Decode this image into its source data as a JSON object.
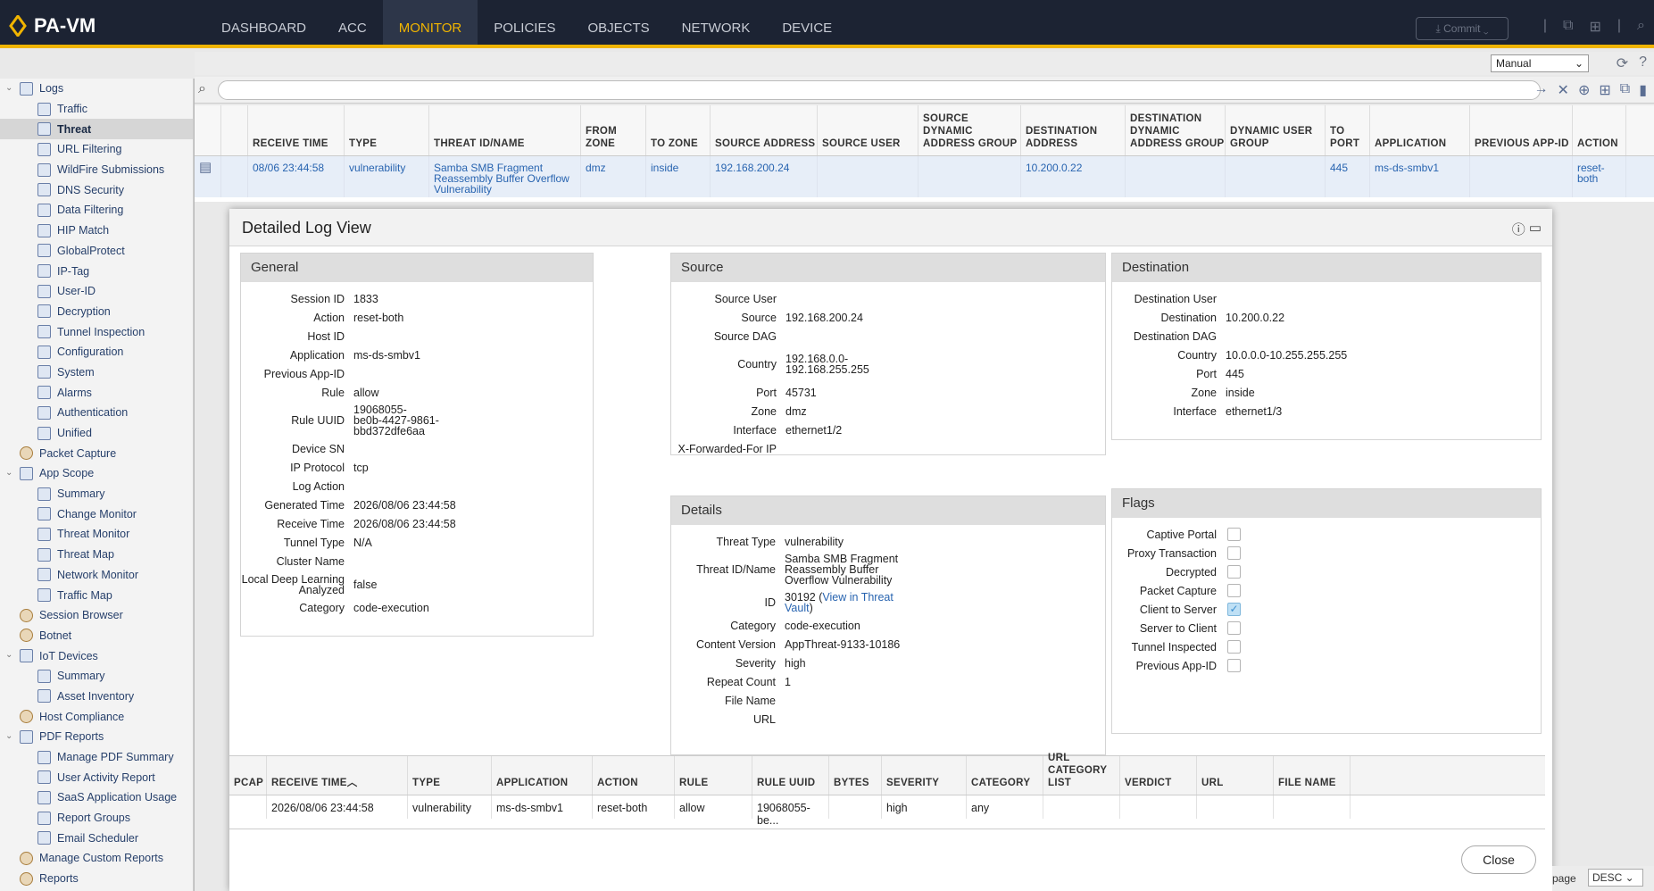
{
  "app": {
    "name": "PA-VM"
  },
  "nav": [
    "DASHBOARD",
    "ACC",
    "MONITOR",
    "POLICIES",
    "OBJECTS",
    "NETWORK",
    "DEVICE"
  ],
  "nav_active": "MONITOR",
  "commit_label": "Commit",
  "refresh_mode": "Manual",
  "sidebar": [
    {
      "label": "Logs",
      "level": 1,
      "caret": true
    },
    {
      "label": "Traffic",
      "level": 2
    },
    {
      "label": "Threat",
      "level": 2,
      "active": true
    },
    {
      "label": "URL Filtering",
      "level": 2
    },
    {
      "label": "WildFire Submissions",
      "level": 2
    },
    {
      "label": "DNS Security",
      "level": 2
    },
    {
      "label": "Data Filtering",
      "level": 2
    },
    {
      "label": "HIP Match",
      "level": 2
    },
    {
      "label": "GlobalProtect",
      "level": 2
    },
    {
      "label": "IP-Tag",
      "level": 2
    },
    {
      "label": "User-ID",
      "level": 2
    },
    {
      "label": "Decryption",
      "level": 2
    },
    {
      "label": "Tunnel Inspection",
      "level": 2
    },
    {
      "label": "Configuration",
      "level": 2
    },
    {
      "label": "System",
      "level": 2
    },
    {
      "label": "Alarms",
      "level": 2
    },
    {
      "label": "Authentication",
      "level": 2
    },
    {
      "label": "Unified",
      "level": 2
    },
    {
      "label": "Packet Capture",
      "level": 1
    },
    {
      "label": "App Scope",
      "level": 1,
      "caret": true
    },
    {
      "label": "Summary",
      "level": 2
    },
    {
      "label": "Change Monitor",
      "level": 2
    },
    {
      "label": "Threat Monitor",
      "level": 2
    },
    {
      "label": "Threat Map",
      "level": 2
    },
    {
      "label": "Network Monitor",
      "level": 2
    },
    {
      "label": "Traffic Map",
      "level": 2
    },
    {
      "label": "Session Browser",
      "level": 1
    },
    {
      "label": "Botnet",
      "level": 1
    },
    {
      "label": "IoT Devices",
      "level": 1,
      "caret": true
    },
    {
      "label": "Summary",
      "level": 2
    },
    {
      "label": "Asset Inventory",
      "level": 2
    },
    {
      "label": "Host Compliance",
      "level": 1
    },
    {
      "label": "PDF Reports",
      "level": 1,
      "caret": true
    },
    {
      "label": "Manage PDF Summary",
      "level": 2
    },
    {
      "label": "User Activity Report",
      "level": 2
    },
    {
      "label": "SaaS Application Usage",
      "level": 2
    },
    {
      "label": "Report Groups",
      "level": 2
    },
    {
      "label": "Email Scheduler",
      "level": 2
    },
    {
      "label": "Manage Custom Reports",
      "level": 1
    },
    {
      "label": "Reports",
      "level": 1
    }
  ],
  "log_table": {
    "columns": [
      "RECEIVE TIME",
      "TYPE",
      "THREAT ID/NAME",
      "FROM ZONE",
      "TO ZONE",
      "SOURCE ADDRESS",
      "SOURCE USER",
      "SOURCE DYNAMIC ADDRESS GROUP",
      "DESTINATION ADDRESS",
      "DESTINATION DYNAMIC ADDRESS GROUP",
      "DYNAMIC USER GROUP",
      "TO PORT",
      "APPLICATION",
      "PREVIOUS APP-ID",
      "ACTION"
    ],
    "row": [
      "08/06 23:44:58",
      "vulnerability",
      "Samba SMB Fragment Reassembly Buffer Overflow Vulnerability",
      "dmz",
      "inside",
      "192.168.200.24",
      "",
      "",
      "10.200.0.22",
      "",
      "",
      "445",
      "ms-ds-smbv1",
      "",
      "reset-both"
    ]
  },
  "modal": {
    "title": "Detailed Log View",
    "general": {
      "title": "General",
      "fields": [
        {
          "k": "Session ID",
          "v": "1833"
        },
        {
          "k": "Action",
          "v": "reset-both"
        },
        {
          "k": "Host ID",
          "v": ""
        },
        {
          "k": "Application",
          "v": "ms-ds-smbv1"
        },
        {
          "k": "Previous App-ID",
          "v": ""
        },
        {
          "k": "Rule",
          "v": "allow"
        },
        {
          "k": "Rule UUID",
          "v": "19068055-\nbe0b-4427-9861-\nbbd372dfe6aa"
        },
        {
          "k": "Device SN",
          "v": ""
        },
        {
          "k": "IP Protocol",
          "v": "tcp"
        },
        {
          "k": "Log Action",
          "v": ""
        },
        {
          "k": "Generated Time",
          "v": "2026/08/06 23:44:58"
        },
        {
          "k": "Receive Time",
          "v": "2026/08/06 23:44:58"
        },
        {
          "k": "Tunnel Type",
          "v": "N/A"
        },
        {
          "k": "Cluster Name",
          "v": ""
        },
        {
          "k": "Local Deep Learning\nAnalyzed",
          "v": "false"
        },
        {
          "k": "Category",
          "v": "code-execution"
        }
      ]
    },
    "source": {
      "title": "Source",
      "fields": [
        {
          "k": "Source User",
          "v": ""
        },
        {
          "k": "Source",
          "v": "192.168.200.24"
        },
        {
          "k": "Source DAG",
          "v": ""
        },
        {
          "k": "Country",
          "v": "192.168.0.0-\n192.168.255.255"
        },
        {
          "k": "Port",
          "v": "45731"
        },
        {
          "k": "Zone",
          "v": "dmz"
        },
        {
          "k": "Interface",
          "v": "ethernet1/2"
        },
        {
          "k": "X-Forwarded-For IP",
          "v": ""
        }
      ]
    },
    "destination": {
      "title": "Destination",
      "fields": [
        {
          "k": "Destination User",
          "v": ""
        },
        {
          "k": "Destination",
          "v": "10.200.0.22"
        },
        {
          "k": "Destination DAG",
          "v": ""
        },
        {
          "k": "Country",
          "v": "10.0.0.0-10.255.255.255"
        },
        {
          "k": "Port",
          "v": "445"
        },
        {
          "k": "Zone",
          "v": "inside"
        },
        {
          "k": "Interface",
          "v": "ethernet1/3"
        }
      ]
    },
    "details": {
      "title": "Details",
      "fields": [
        {
          "k": "Threat Type",
          "v": "vulnerability"
        },
        {
          "k": "Threat ID/Name",
          "v": "Samba SMB Fragment\nReassembly Buffer\nOverflow Vulnerability"
        },
        {
          "k": "ID",
          "v": "30192 (",
          "link": "View in Threat\nVault",
          "after": ")"
        },
        {
          "k": "Category",
          "v": "code-execution"
        },
        {
          "k": "Content Version",
          "v": "AppThreat-9133-10186"
        },
        {
          "k": "Severity",
          "v": "high"
        },
        {
          "k": "Repeat Count",
          "v": "1"
        },
        {
          "k": "File Name",
          "v": ""
        },
        {
          "k": "URL",
          "v": ""
        }
      ]
    },
    "flags": {
      "title": "Flags",
      "fields": [
        {
          "k": "Captive Portal",
          "checked": false
        },
        {
          "k": "Proxy Transaction",
          "checked": false
        },
        {
          "k": "Decrypted",
          "checked": false
        },
        {
          "k": "Packet Capture",
          "checked": false
        },
        {
          "k": "Client to Server",
          "checked": true
        },
        {
          "k": "Server to Client",
          "checked": false
        },
        {
          "k": "Tunnel Inspected",
          "checked": false
        },
        {
          "k": "Previous App-ID",
          "checked": false
        }
      ]
    },
    "bottom_table": {
      "columns": [
        "PCAP",
        "RECEIVE TIME",
        "TYPE",
        "APPLICATION",
        "ACTION",
        "RULE",
        "RULE UUID",
        "BYTES",
        "SEVERITY",
        "CATEGORY",
        "URL CATEGORY LIST",
        "VERDICT",
        "URL",
        "FILE NAME"
      ],
      "row": [
        "",
        "2026/08/06 23:44:58",
        "vulnerability",
        "ms-ds-smbv1",
        "reset-both",
        "allow",
        "19068055-be...",
        "",
        "high",
        "any",
        "",
        "",
        "",
        ""
      ]
    },
    "close_label": "Close"
  },
  "pager": {
    "label": "page",
    "sort": "DESC"
  }
}
